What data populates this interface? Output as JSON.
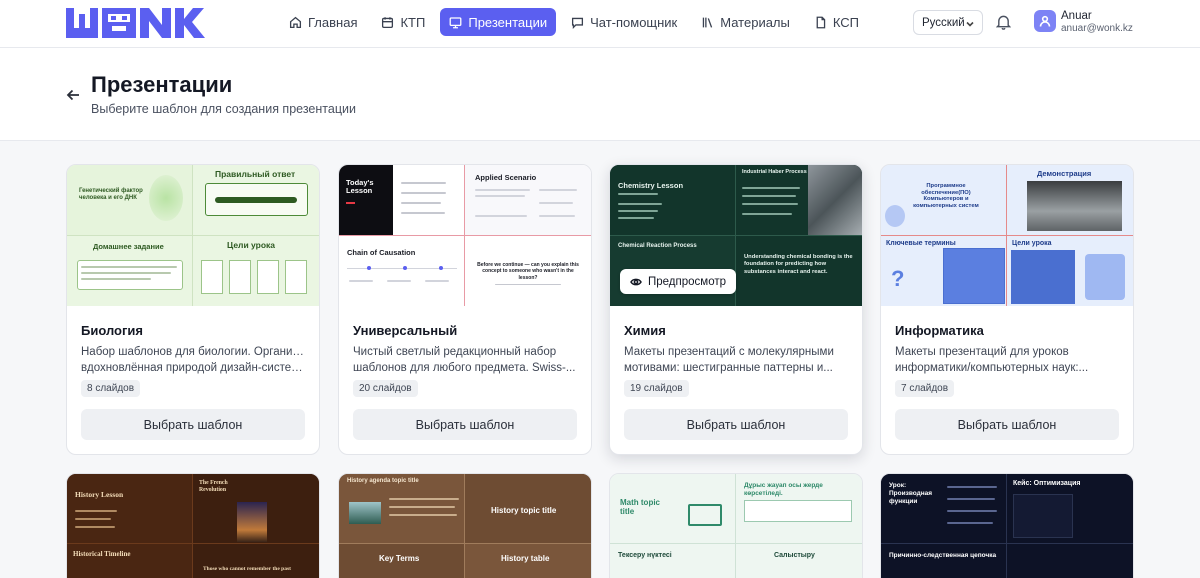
{
  "brand": {
    "logo_text": "WONK",
    "accent": "#5b5ff0"
  },
  "nav": [
    {
      "label": "Главная",
      "icon": "home-icon"
    },
    {
      "label": "КТП",
      "icon": "calendar-icon"
    },
    {
      "label": "Презентации",
      "icon": "monitor-icon",
      "active": true
    },
    {
      "label": "Чат-помощник",
      "icon": "chat-icon"
    },
    {
      "label": "Материалы",
      "icon": "library-icon"
    },
    {
      "label": "КСП",
      "icon": "file-icon"
    }
  ],
  "language": {
    "selected": "Русский"
  },
  "user": {
    "name": "Anuar",
    "email": "anuar@wonk.kz"
  },
  "page": {
    "title": "Презентации",
    "subtitle": "Выберите шаблон для создания презентации"
  },
  "cards": [
    {
      "title": "Биология",
      "desc_lines": [
        "Набор шаблонов для биологии. Органичная,",
        "вдохновлённая природой дизайн-система ..."
      ],
      "slides": "8 слайдов",
      "button": "Выбрать шаблон",
      "thumb": {
        "tl": "Генетический фактор человека и его ДНК",
        "tr": "Правильный ответ",
        "bl": "Домашнее задание",
        "br": "Цели урока"
      }
    },
    {
      "title": "Универсальный",
      "desc_lines": [
        "Чистый светлый редакционный набор",
        "шаблонов для любого предмета. Swiss-..."
      ],
      "slides": "20 слайдов",
      "button": "Выбрать шаблон",
      "thumb": {
        "tl": "Today's Lesson",
        "tr": "Applied Scenario",
        "bl": "Chain of Causation",
        "br": "Before we continue — can you explain this concept to someone who wasn't in the lesson?"
      }
    },
    {
      "title": "Химия",
      "desc_lines": [
        "Макеты презентаций с молекулярными",
        "мотивами: шестигранные паттерны и..."
      ],
      "slides": "19 слайдов",
      "button": "Выбрать шаблон",
      "preview": "Предпросмотр",
      "thumb": {
        "tl": "Chemistry Lesson",
        "tr": "Industrial Haber Process",
        "bl": "Chemical Reaction Process",
        "br": "Understanding chemical bonding is the foundation for predicting how substances interact and react."
      }
    },
    {
      "title": "Информатика",
      "desc_lines": [
        "Макеты презентаций для уроков",
        "информатики/компьютерных наук:..."
      ],
      "slides": "7 слайдов",
      "button": "Выбрать шаблон",
      "thumb": {
        "tl": "Программное обеспечение(ПО) Компьютеров и компьютерных систем",
        "tr": "Демонстрация",
        "bl": "Ключевые термины",
        "br": "Цели урока"
      }
    }
  ],
  "row2": [
    {
      "tl": "History Lesson",
      "tr": "The French Revolution",
      "bl": "Historical Timeline",
      "br": "Those who cannot remember the past"
    },
    {
      "tl": "History agenda topic title",
      "tr": "History topic title",
      "bl": "Key Terms",
      "br": "History table"
    },
    {
      "tl": "Math topic title",
      "tr": "Дұрыс жауап осы жерде көрсетіледі.",
      "bl": "Тексеру нүктесі",
      "br": "Салыстыру"
    },
    {
      "tl": "Урок: Производная функции",
      "tr": "Кейс: Оптимизация",
      "bl": "Причинно-следственная цепочка",
      "br": ""
    }
  ]
}
